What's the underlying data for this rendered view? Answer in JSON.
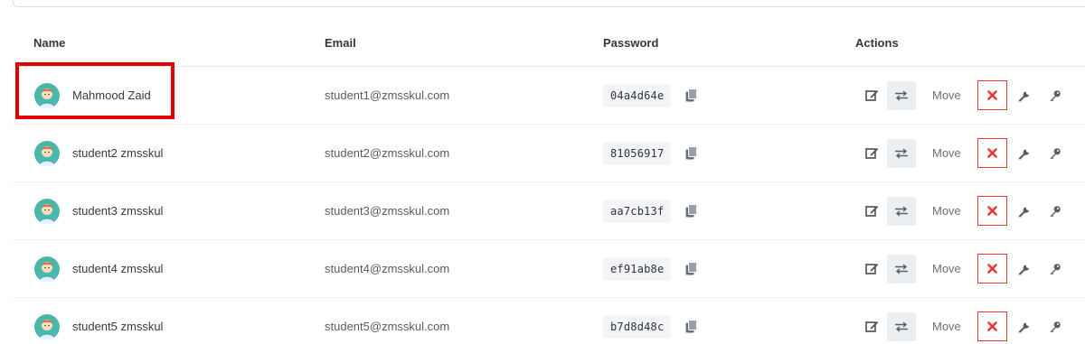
{
  "table": {
    "headers": {
      "name": "Name",
      "email": "Email",
      "password": "Password",
      "actions": "Actions"
    },
    "move_label": "Move",
    "rows": [
      {
        "name": "Mahmood Zaid",
        "email": "student1@zmsskul.com",
        "password": "04a4d64e"
      },
      {
        "name": "student2 zmsskul",
        "email": "student2@zmsskul.com",
        "password": "81056917"
      },
      {
        "name": "student3 zmsskul",
        "email": "student3@zmsskul.com",
        "password": "aa7cb13f"
      },
      {
        "name": "student4 zmsskul",
        "email": "student4@zmsskul.com",
        "password": "ef91ab8e"
      },
      {
        "name": "student5 zmsskul",
        "email": "student5@zmsskul.com",
        "password": "b7d8d48c"
      }
    ]
  },
  "icons": {
    "avatar": "student-avatar-icon",
    "copy": "copy-icon",
    "edit": "edit-icon",
    "transfer": "transfer-icon",
    "delete": "close-icon",
    "wrench": "wrench-icon",
    "key": "key-icon"
  },
  "colors": {
    "delete_accent": "#e53935",
    "highlight": "#e00000",
    "avatar_bg": "#4db6ac"
  }
}
